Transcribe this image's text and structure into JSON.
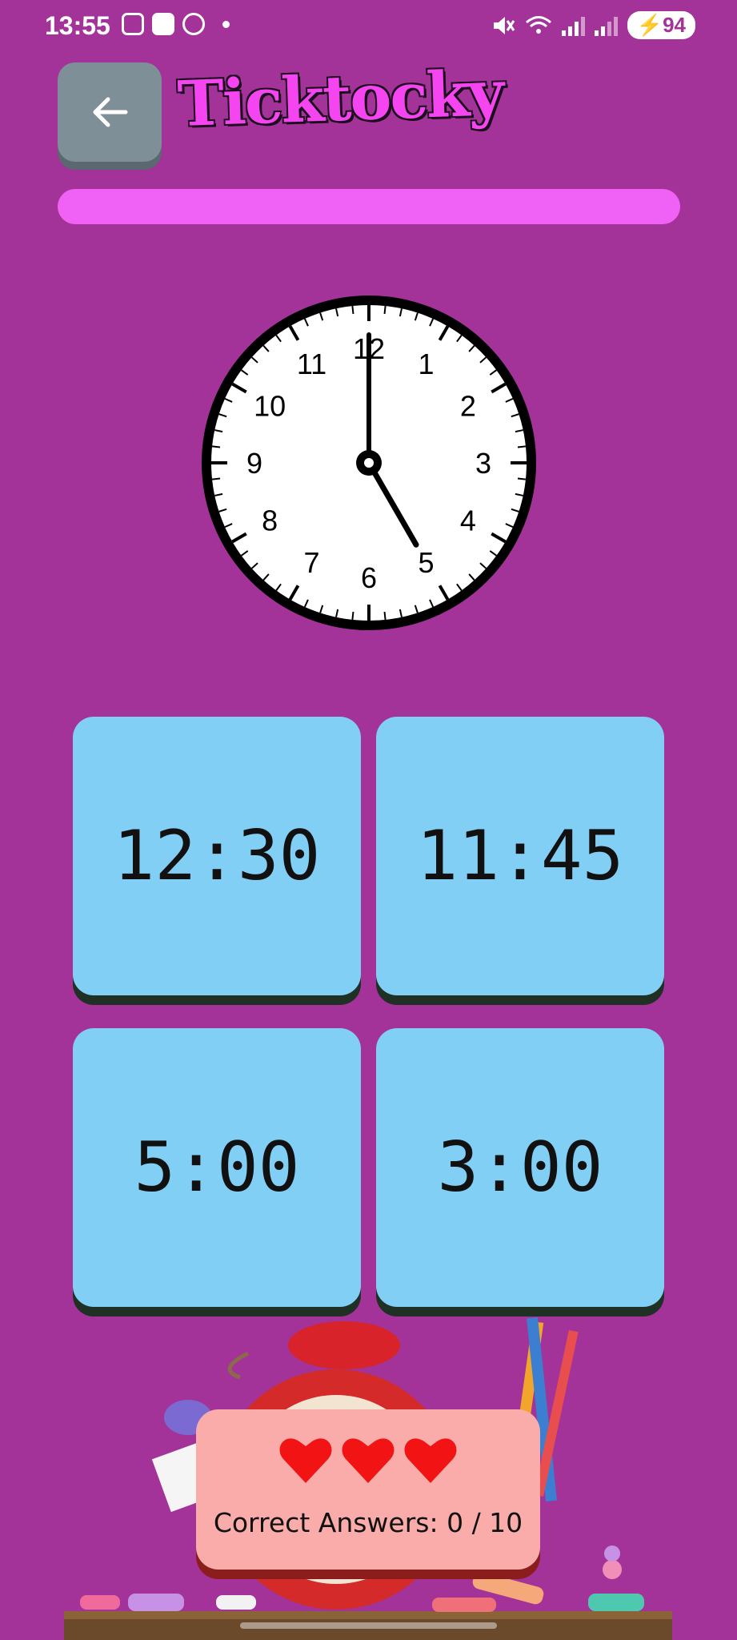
{
  "status": {
    "time": "13:55",
    "battery": "94"
  },
  "header": {
    "back_icon": "arrow-left-icon",
    "logo_text": "Ticktocky"
  },
  "quiz": {
    "progress": 0,
    "clock": {
      "hour": 5,
      "minute": 0
    },
    "answers": [
      "12:30",
      "11:45",
      "5:00",
      "3:00"
    ]
  },
  "score": {
    "lives": 3,
    "label": "Correct Answers: 0 / 10"
  },
  "colors": {
    "background": "#A33399",
    "progress_bar": "#F062F5",
    "answer_tile": "#82CFF6",
    "score_card": "#F9ACAA",
    "heart": "#F21414"
  }
}
